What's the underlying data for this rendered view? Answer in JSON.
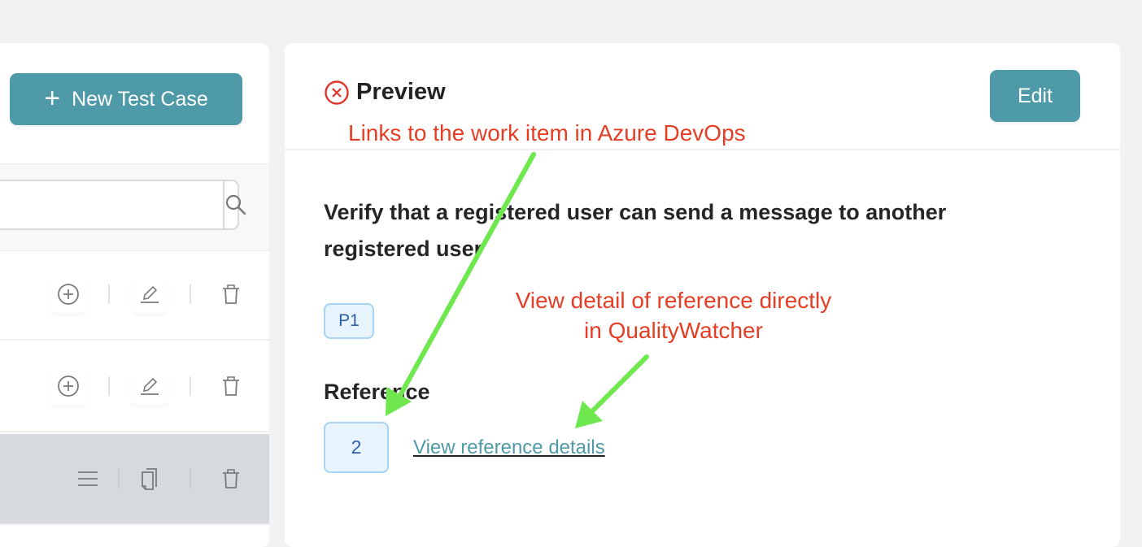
{
  "left_panel": {
    "new_test_case_button": {
      "icon": "plus-icon",
      "label": "New Test Case"
    },
    "search": {
      "placeholder_fragment": "e",
      "icon": "search-icon"
    },
    "rows": [
      {
        "selected": false,
        "actions": [
          "add-circle-icon",
          "pencil-icon",
          "trash-icon"
        ]
      },
      {
        "selected": false,
        "actions": [
          "add-circle-icon",
          "pencil-icon",
          "trash-icon"
        ]
      },
      {
        "selected": true,
        "actions": [
          "menu-icon",
          "copy-icon",
          "trash-icon"
        ]
      }
    ]
  },
  "preview": {
    "close_icon": "close-circle-icon",
    "title": "Preview",
    "edit_button": "Edit",
    "test_case_title": "Verify that a registered user can send a message to another registered user",
    "priority": "P1",
    "reference_label": "Reference",
    "reference_id": "2",
    "reference_link": "View reference details"
  },
  "annotations": {
    "text_1": "Links to the work item in Azure DevOps",
    "text_2_line1": "View detail of reference directly",
    "text_2_line2": "in QualityWatcher",
    "text_color": "#e53e25",
    "arrow_color": "#6fe84f"
  },
  "colors": {
    "accent": "#4f9aa8",
    "badge_bg": "#e7f3fd",
    "badge_border": "#a7d3f5",
    "selected_row": "#d6d9de"
  }
}
